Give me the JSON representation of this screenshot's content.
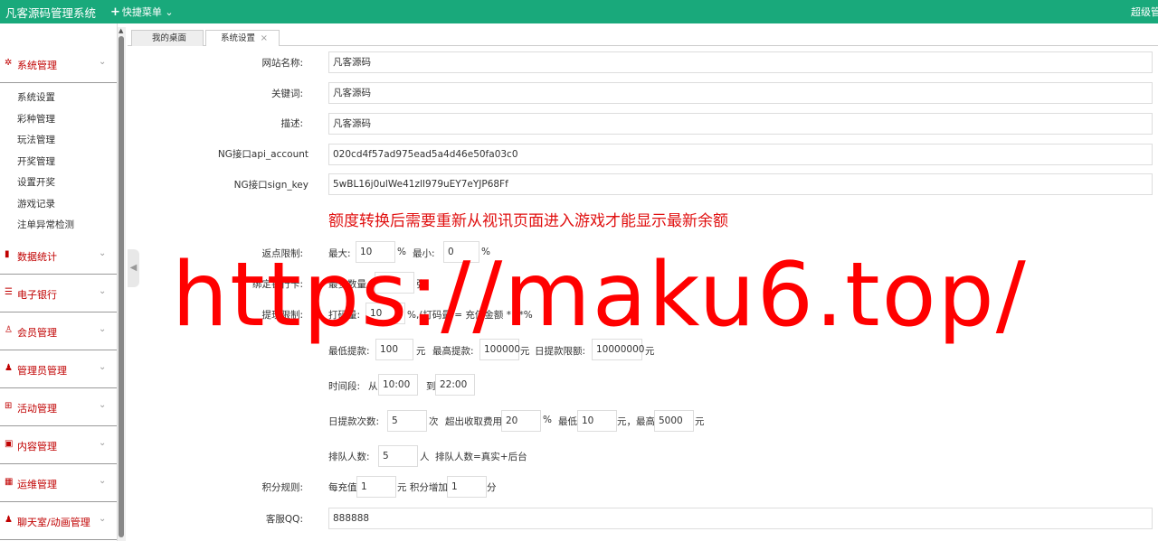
{
  "topbar": {
    "title": "凡客源码管理系统",
    "quick_menu": "快捷菜单",
    "user": "超级管"
  },
  "sidebar": {
    "groups": [
      {
        "label": "系统管理",
        "icon": "gear-icon"
      },
      {
        "label": "数据统计",
        "icon": "bar-chart-icon"
      },
      {
        "label": "电子银行",
        "icon": "list-icon"
      },
      {
        "label": "会员管理",
        "icon": "user-outline-icon"
      },
      {
        "label": "管理员管理",
        "icon": "user-icon"
      },
      {
        "label": "活动管理",
        "icon": "gift-icon"
      },
      {
        "label": "内容管理",
        "icon": "inbox-icon"
      },
      {
        "label": "运维管理",
        "icon": "tool-icon"
      },
      {
        "label": "聊天室/动画管理",
        "icon": "user-icon"
      }
    ],
    "sub_items": [
      "系统设置",
      "彩种管理",
      "玩法管理",
      "开奖管理",
      "设置开奖",
      "游戏记录",
      "注单异常检测"
    ]
  },
  "tabs": [
    {
      "label": "我的桌面"
    },
    {
      "label": "系统设置"
    }
  ],
  "form": {
    "site_name_label": "网站名称:",
    "site_name": "凡客源码",
    "keywords_label": "关键词:",
    "keywords": "凡客源码",
    "desc_label": "描述:",
    "desc": "凡客源码",
    "api_account_label": "NG接口api_account",
    "api_account": "020cd4f57ad975ead5a4d46e50fa03c0",
    "sign_key_label": "NG接口sign_key",
    "sign_key": "5wBL16j0ulWe41zlI979uEY7eYJP68Ff",
    "notice": "额度转换后需要重新从视讯页面进入游戏才能显示最新余额",
    "rebate_label": "返点限制:",
    "rebate_max_label": "最大:",
    "rebate_max": "10",
    "rebate_min_label": "最小:",
    "rebate_min": "0",
    "percent": "%",
    "card_label": "绑定银行卡:",
    "card_max_label": "最多数量",
    "card_unit": "张",
    "withdraw_label": "提现限制:",
    "bet_label": "打码量:",
    "bet_value": "10",
    "bet_formula": "%,(打码量 = 充值金额 * **%",
    "min_withdraw_label": "最低提款:",
    "min_withdraw": "100",
    "yuan": "元",
    "max_withdraw_label": "最高提款:",
    "max_withdraw": "100000",
    "daily_limit_label": "日提款限额:",
    "daily_limit": "10000000",
    "period_label": "时间段:",
    "from_label": "从",
    "from_time": "10:00",
    "to_label": "到",
    "to_time": "22:00",
    "daily_times_label": "日提款次数:",
    "daily_times": "5",
    "times_unit": "次",
    "excess_fee_label": "超出收取费用",
    "excess_fee": "20",
    "fee_min_label": "最低",
    "fee_min": "10",
    "fee_max_label": "元，最高",
    "fee_max": "5000",
    "queue_label": "排队人数:",
    "queue": "5",
    "queue_unit": "人",
    "queue_note": "排队人数=真实+后台",
    "points_label": "积分规则:",
    "points_recharge_label": "每充值",
    "points_recharge": "1",
    "points_add_label": "元 积分增加",
    "points_add": "1",
    "points_unit": "分",
    "qq_label": "客服QQ:",
    "qq": "888888"
  },
  "watermark": "https://maku6.top/"
}
